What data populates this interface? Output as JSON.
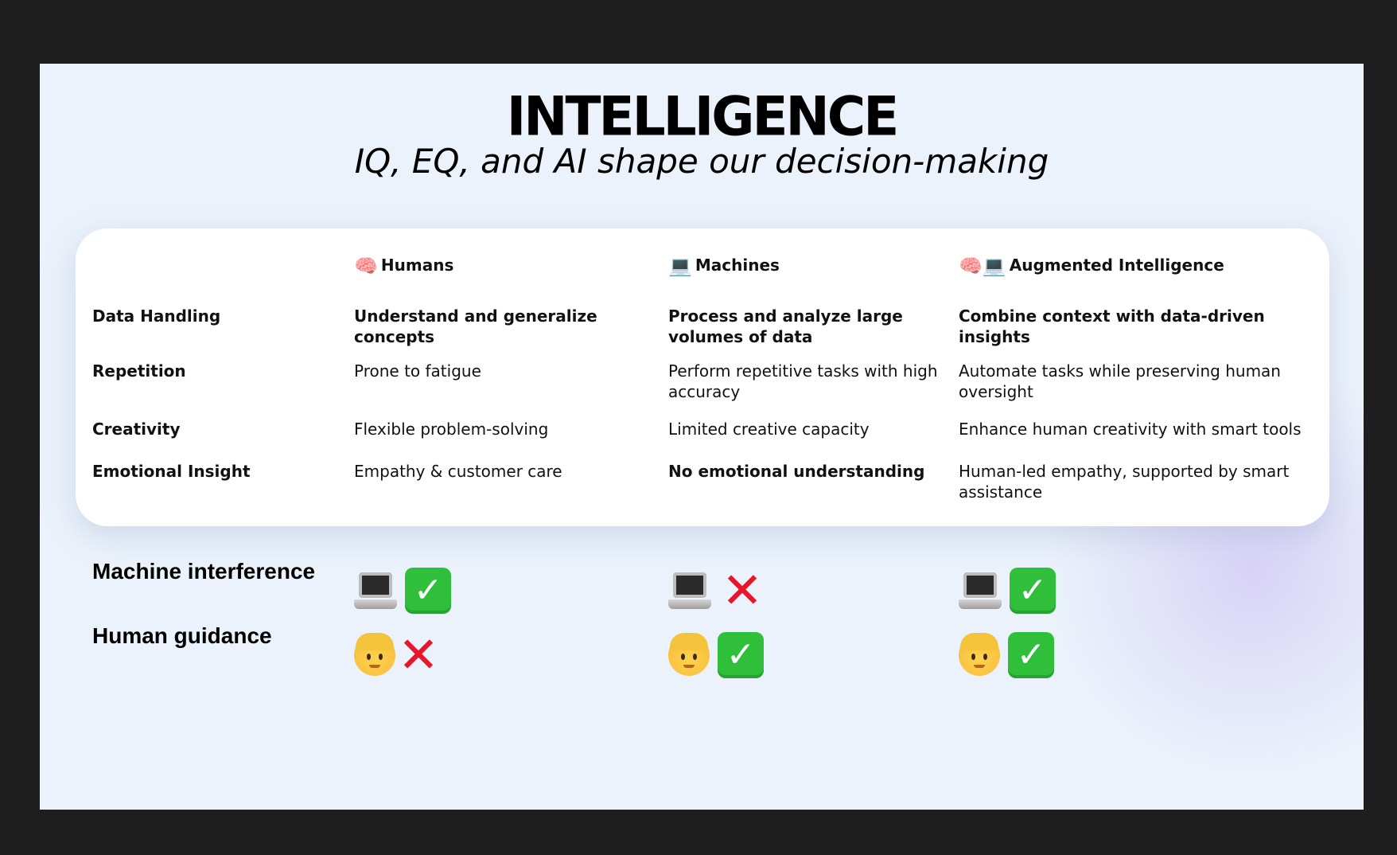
{
  "title": "INTELLIGENCE",
  "subtitle": "IQ, EQ, and AI shape our decision-making",
  "columns": [
    {
      "icon": "🧠",
      "label": "Humans"
    },
    {
      "icon": "💻",
      "label": "Machines"
    },
    {
      "icon": "🧠💻",
      "label": "Augmented Intelligence"
    }
  ],
  "rows": [
    {
      "label": "Data Handling",
      "cells": [
        "Understand and generalize concepts",
        "Process and analyze large volumes of data",
        "Combine context with data-driven insights"
      ]
    },
    {
      "label": "Repetition",
      "cells": [
        "Prone to fatigue",
        "Perform repetitive tasks with high accuracy",
        "Automate tasks while preserving human oversight"
      ]
    },
    {
      "label": "Creativity",
      "cells": [
        "Flexible problem-solving",
        "Limited creative capacity",
        "Enhance human creativity with smart tools"
      ]
    },
    {
      "label": "Emotional Insight",
      "cells": [
        "Empathy & customer care",
        "No emotional understanding",
        "Human-led empathy, supported by smart assistance"
      ]
    }
  ],
  "indicators": {
    "machine_interference": {
      "label": "Machine interference",
      "values": [
        true,
        false,
        true
      ]
    },
    "human_guidance": {
      "label": "Human guidance",
      "values": [
        false,
        true,
        true
      ]
    }
  },
  "icons": {
    "check": "✓",
    "cross": "✕"
  },
  "colors": {
    "check_bg": "#2fbf3a",
    "cross": "#e8162b",
    "slide_bg": "#ebf2fb"
  }
}
